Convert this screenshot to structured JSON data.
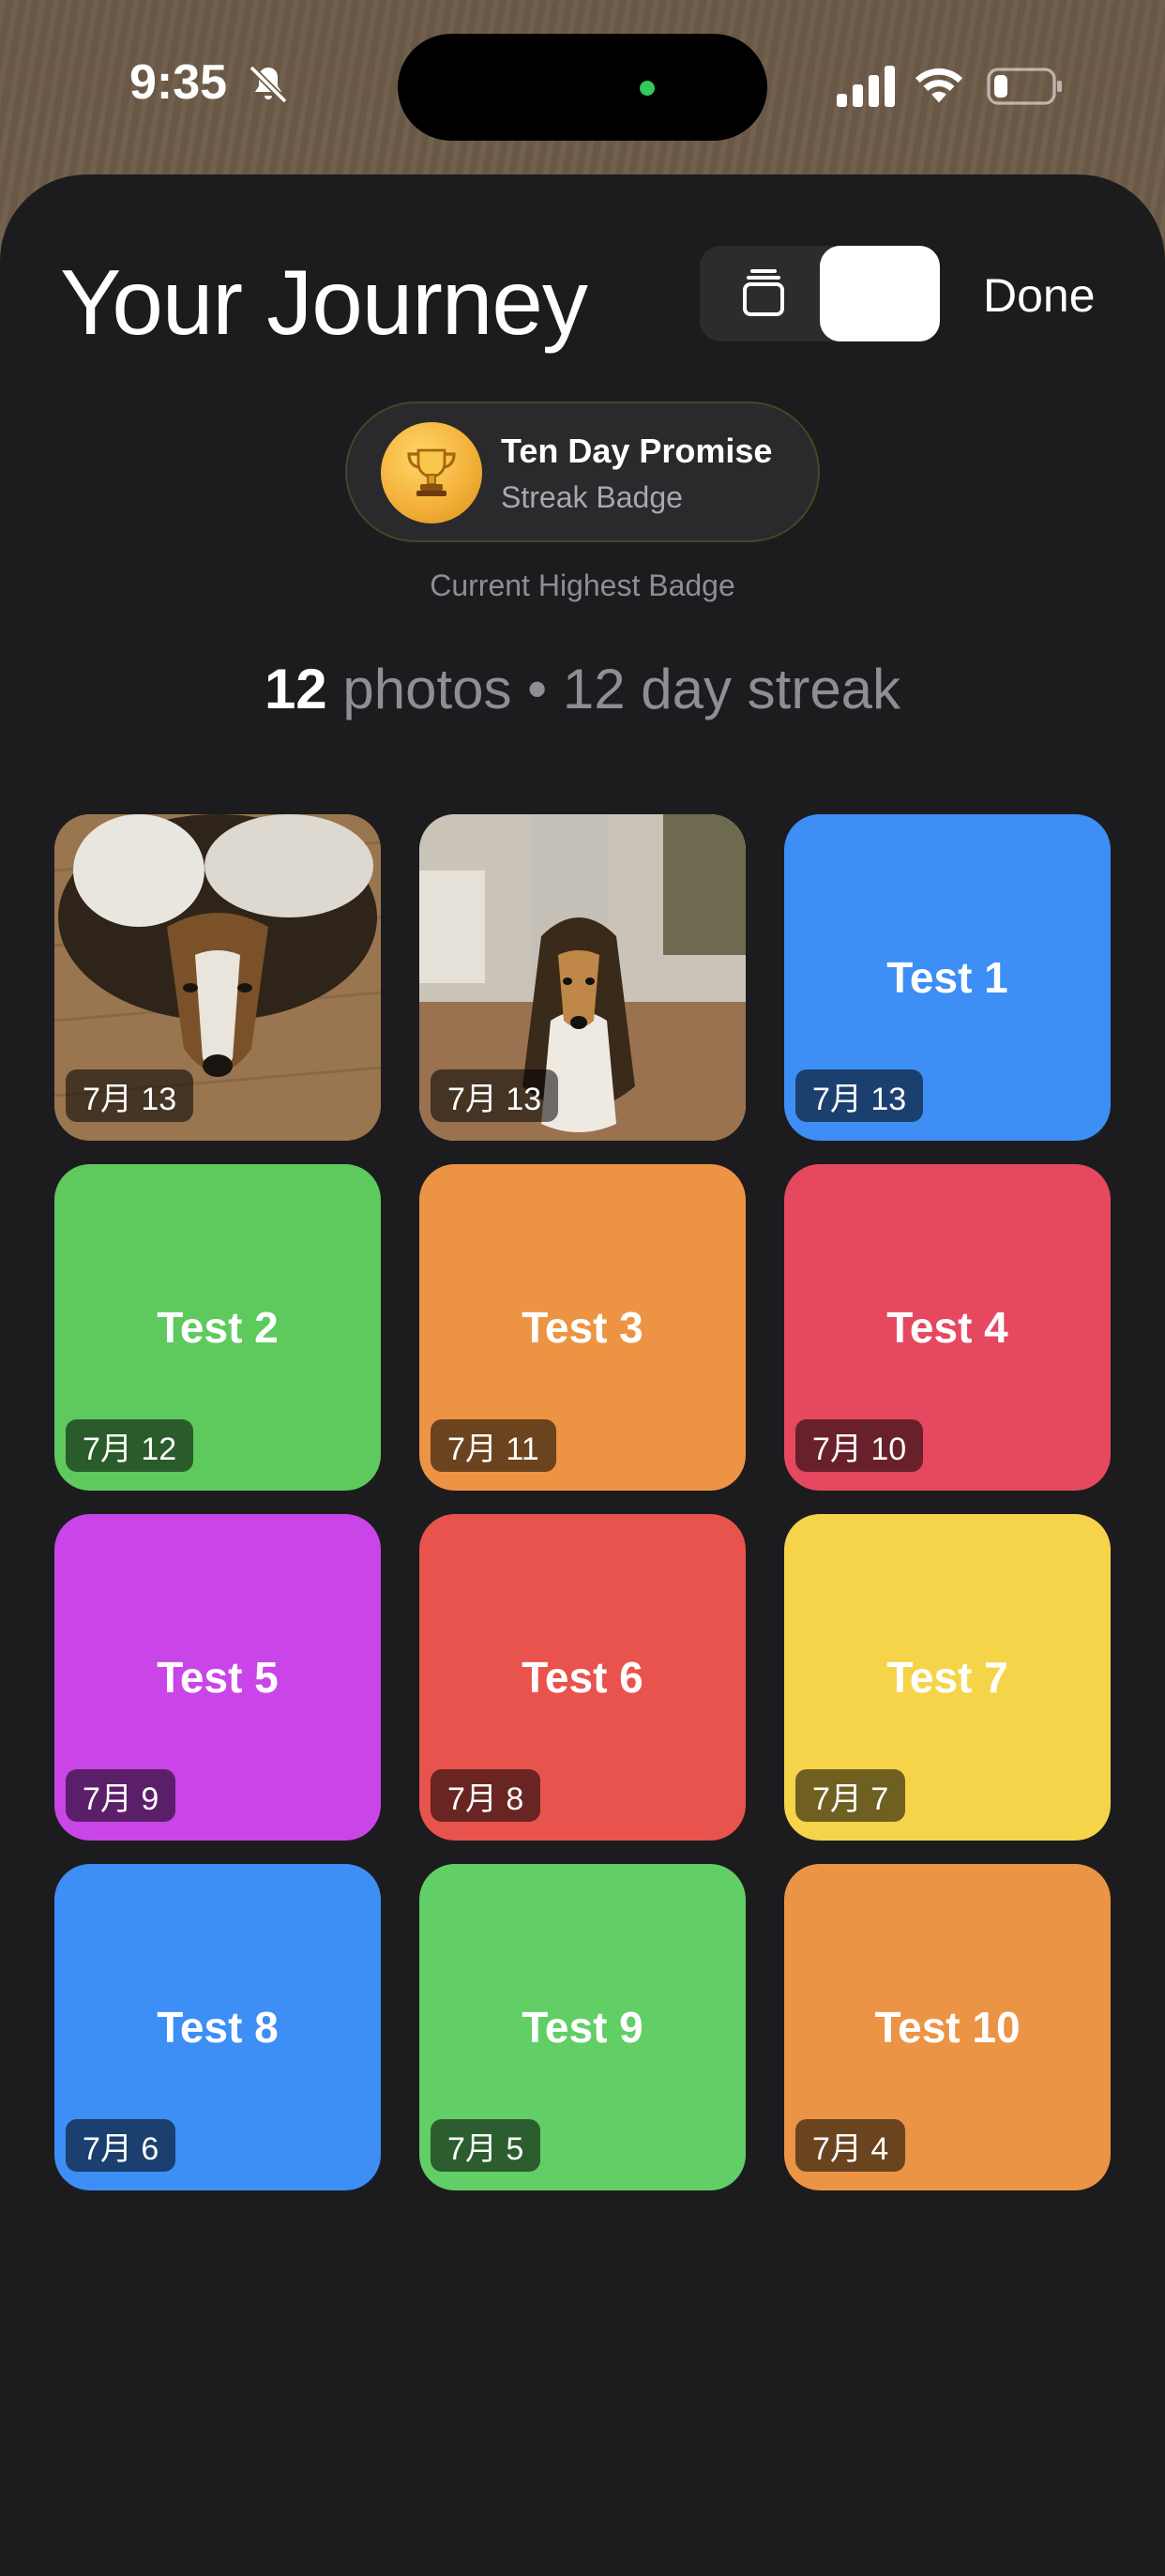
{
  "status_bar": {
    "time": "9:35"
  },
  "header": {
    "title": "Your Journey",
    "done_label": "Done"
  },
  "badge": {
    "name": "Ten Day Promise",
    "type": "Streak Badge",
    "caption": "Current Highest Badge",
    "icon": "trophy-icon"
  },
  "stats": {
    "photo_count": "12",
    "photo_text": " photos • 12 day streak"
  },
  "tiles": [
    {
      "kind": "photo",
      "label": "",
      "date": "7月 13"
    },
    {
      "kind": "photo",
      "label": "",
      "date": "7月 13"
    },
    {
      "kind": "color",
      "label": "Test 1",
      "date": "7月 13",
      "color": "#3d8ef5"
    },
    {
      "kind": "color",
      "label": "Test 2",
      "date": "7月 12",
      "color": "#5ec95d"
    },
    {
      "kind": "color",
      "label": "Test 3",
      "date": "7月 11",
      "color": "#ed9444"
    },
    {
      "kind": "color",
      "label": "Test 4",
      "date": "7月 10",
      "color": "#e6485f"
    },
    {
      "kind": "color",
      "label": "Test 5",
      "date": "7月 9",
      "color": "#c945e8"
    },
    {
      "kind": "color",
      "label": "Test 6",
      "date": "7月 8",
      "color": "#e9534d"
    },
    {
      "kind": "color",
      "label": "Test 7",
      "date": "7月 7",
      "color": "#f6d44a"
    },
    {
      "kind": "color",
      "label": "Test 8",
      "date": "7月 6",
      "color": "#3d8ef5"
    },
    {
      "kind": "color",
      "label": "Test 9",
      "date": "7月 5",
      "color": "#62ce66"
    },
    {
      "kind": "color",
      "label": "Test 10",
      "date": "7月 4",
      "color": "#ec9445"
    }
  ]
}
